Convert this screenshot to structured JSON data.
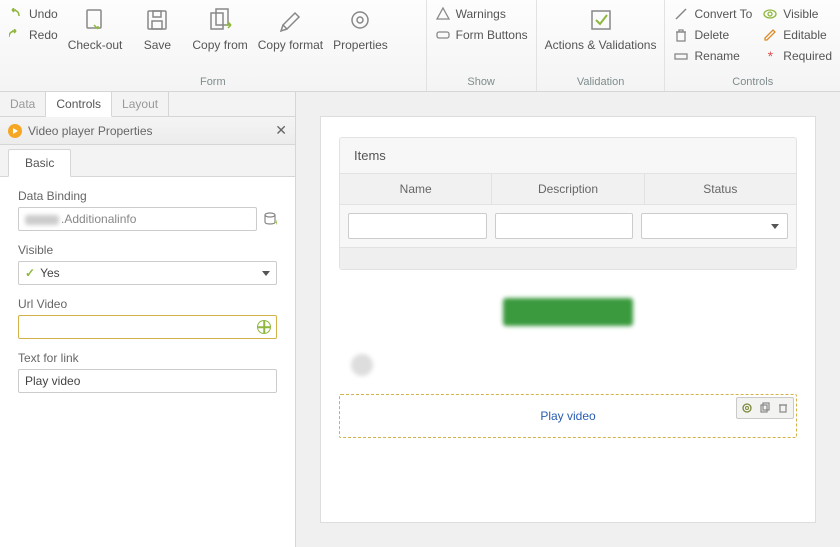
{
  "ribbon": {
    "undo": "Undo",
    "redo": "Redo",
    "checkout": "Check-out",
    "save": "Save",
    "copyfrom": "Copy from",
    "copyformat": "Copy format",
    "properties": "Properties",
    "group_form": "Form",
    "warnings": "Warnings",
    "formbuttons": "Form Buttons",
    "group_show": "Show",
    "actions_validations": "Actions & Validations",
    "group_validation": "Validation",
    "convert_to": "Convert To",
    "delete": "Delete",
    "rename": "Rename",
    "visible": "Visible",
    "editable": "Editable",
    "required": "Required",
    "group_controls": "Controls"
  },
  "left": {
    "tab_data": "Data",
    "tab_controls": "Controls",
    "tab_layout": "Layout",
    "panel_title": "Video player Properties",
    "prop_tab_basic": "Basic",
    "data_binding_label": "Data Binding",
    "data_binding_value": ".Additionalinfo",
    "visible_label": "Visible",
    "visible_value": "Yes",
    "url_video_label": "Url Video",
    "url_video_value": "",
    "text_for_link_label": "Text for link",
    "text_for_link_value": "Play video"
  },
  "canvas": {
    "items_title": "Items",
    "col_name": "Name",
    "col_description": "Description",
    "col_status": "Status",
    "video_link_text": "Play video"
  }
}
